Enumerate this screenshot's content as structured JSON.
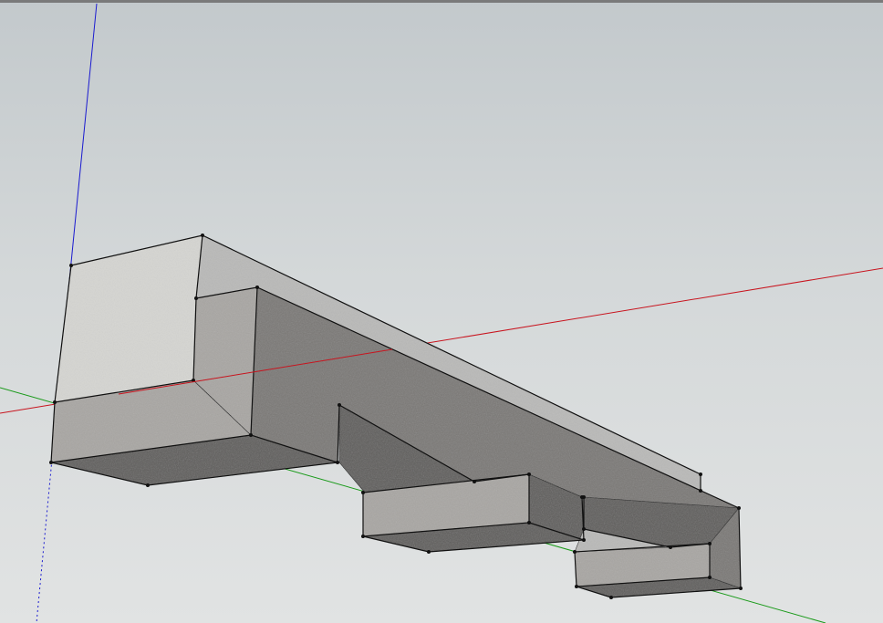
{
  "app": {
    "kind": "3d-modeling-viewport"
  },
  "scene": {
    "model": "concrete-beam-with-stepped-blocks",
    "axes": {
      "red": "#c8141e",
      "green": "#1a9a1a",
      "blue": "#1a1ad0"
    },
    "material": {
      "top_face": "#b9b9b8",
      "end_face_light": "#d5d5d2",
      "front_face": "#7a7876",
      "underside": "#5f5d5b",
      "block_face": "#a8a6a3",
      "edge": "#111111"
    },
    "background": {
      "top": "#c3c9cc",
      "bottom": "#e1e3e3"
    }
  }
}
